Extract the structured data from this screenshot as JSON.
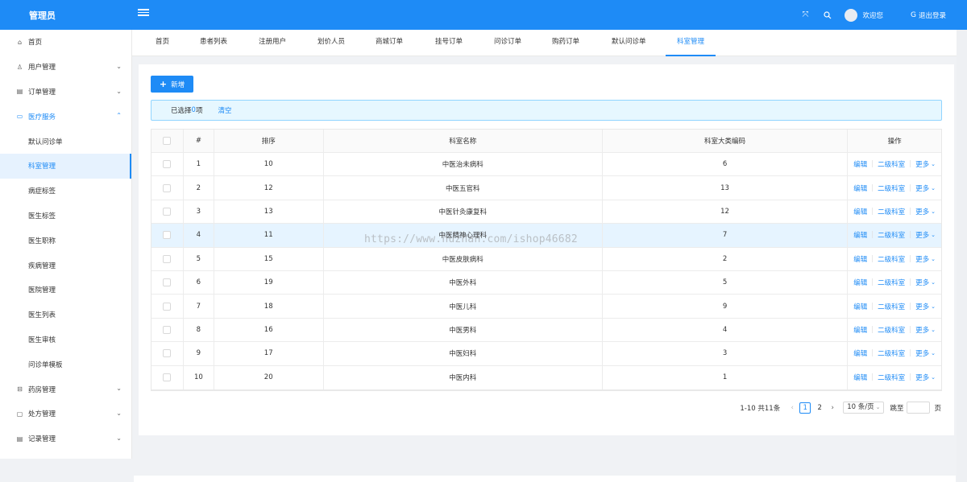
{
  "header": {
    "brand": "管理员",
    "welcome": "欢迎您",
    "logout": "退出登录"
  },
  "sidebar": {
    "items": [
      {
        "label": "首页",
        "icon": "home-icon",
        "glyph": "⌂",
        "chevron": ""
      },
      {
        "label": "用户管理",
        "icon": "user-icon",
        "glyph": "♙",
        "chevron": "⌄"
      },
      {
        "label": "订单管理",
        "icon": "order-icon",
        "glyph": "▤",
        "chevron": "⌄"
      },
      {
        "label": "医疗服务",
        "icon": "monitor-icon",
        "glyph": "▭",
        "chevron": "⌃"
      },
      {
        "label": "默认问诊单"
      },
      {
        "label": "科室管理"
      },
      {
        "label": "病症标签"
      },
      {
        "label": "医生标签"
      },
      {
        "label": "医生职称"
      },
      {
        "label": "疾病管理"
      },
      {
        "label": "医院管理"
      },
      {
        "label": "医生列表"
      },
      {
        "label": "医生审核"
      },
      {
        "label": "问诊单模板"
      },
      {
        "label": "药房管理",
        "icon": "pharmacy-icon",
        "glyph": "⊟",
        "chevron": "⌄"
      },
      {
        "label": "处方管理",
        "icon": "prescription-icon",
        "glyph": "▢",
        "chevron": "⌄"
      },
      {
        "label": "记录管理",
        "icon": "record-icon",
        "glyph": "▤",
        "chevron": "⌄"
      }
    ]
  },
  "tabs": [
    "首页",
    "患者列表",
    "注册用户",
    "划价人员",
    "商城订单",
    "挂号订单",
    "问诊订单",
    "购药订单",
    "默认问诊单",
    "科室管理"
  ],
  "toolbar": {
    "add_label": "新增"
  },
  "alert": {
    "prefix": "已选择 ",
    "count": "0",
    "suffix": "项",
    "clear": "清空"
  },
  "table": {
    "columns": [
      "#",
      "排序",
      "科室名称",
      "科室大类编码",
      "操作"
    ],
    "rows": [
      {
        "idx": "1",
        "sort": "10",
        "name": "中医治未病科",
        "code": "6"
      },
      {
        "idx": "2",
        "sort": "12",
        "name": "中医五官科",
        "code": "13"
      },
      {
        "idx": "3",
        "sort": "13",
        "name": "中医针灸康复科",
        "code": "12"
      },
      {
        "idx": "4",
        "sort": "11",
        "name": "中医精神心理科",
        "code": "7"
      },
      {
        "idx": "5",
        "sort": "15",
        "name": "中医皮肤病科",
        "code": "2"
      },
      {
        "idx": "6",
        "sort": "19",
        "name": "中医外科",
        "code": "5"
      },
      {
        "idx": "7",
        "sort": "18",
        "name": "中医儿科",
        "code": "9"
      },
      {
        "idx": "8",
        "sort": "16",
        "name": "中医男科",
        "code": "4"
      },
      {
        "idx": "9",
        "sort": "17",
        "name": "中医妇科",
        "code": "3"
      },
      {
        "idx": "10",
        "sort": "20",
        "name": "中医内科",
        "code": "1"
      }
    ],
    "actions": {
      "edit": "编辑",
      "sub": "二级科室",
      "more": "更多"
    }
  },
  "watermark": "https://www.huzhan.com/ishop46682",
  "pagination": {
    "total": "1-10 共11条",
    "pages": [
      "1",
      "2"
    ],
    "current": "1",
    "size": "10 条/页",
    "jump": "跳至",
    "page_unit": "页"
  },
  "colors": {
    "primary": "#1e8bf6",
    "highlight_row": "#e6f4ff"
  }
}
